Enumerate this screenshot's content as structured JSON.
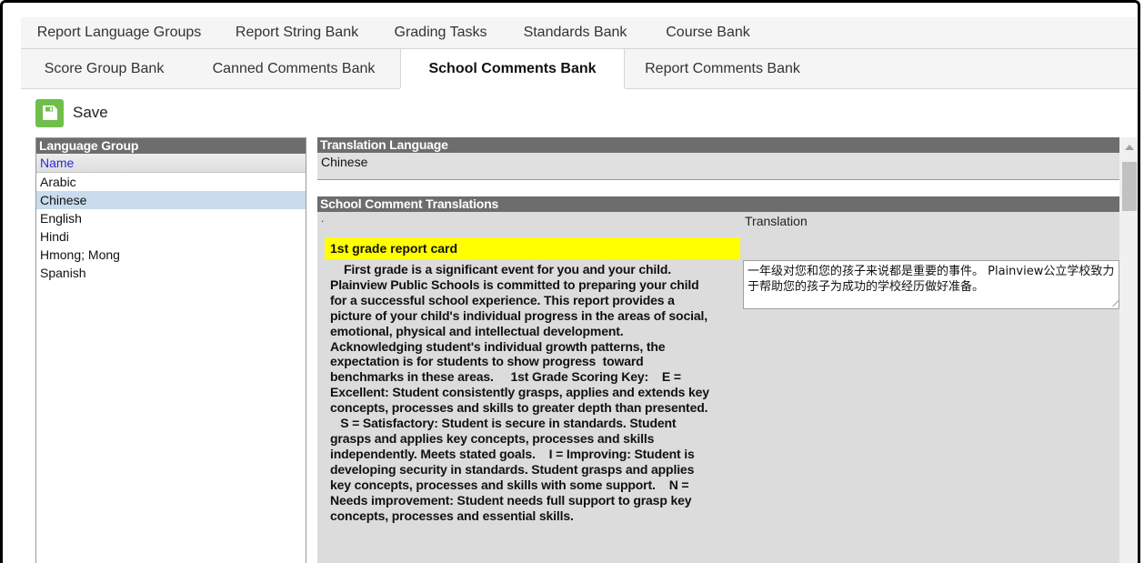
{
  "tabs_row1": [
    "Report Language Groups",
    "Report String Bank",
    "Grading Tasks",
    "Standards Bank",
    "Course Bank"
  ],
  "tabs_row2": [
    "Score Group Bank",
    "Canned Comments Bank",
    "School Comments Bank",
    "Report Comments Bank"
  ],
  "toolbar": {
    "save_label": "Save",
    "save_icon": "floppy-disk-icon"
  },
  "language_group": {
    "header": "Language Group",
    "column": "Name",
    "items": [
      "Arabic",
      "Chinese",
      "English",
      "Hindi",
      "Hmong; Mong",
      "Spanish"
    ],
    "selected": "Chinese"
  },
  "translation_language": {
    "header": "Translation Language",
    "value": "Chinese"
  },
  "school_comment_translations": {
    "header": "School Comment Translations",
    "dot": ".",
    "translation_label": "Translation",
    "comment_title": "1st grade report card",
    "comment_body": "    First grade is a significant event for you and your child.\nPlainview Public Schools is committed to preparing your child\nfor a successful school experience. This report provides a\npicture of your child's individual progress in the areas of social,\nemotional, physical and intellectual development.\nAcknowledging student's individual growth patterns, the\nexpectation is for students to show progress  toward\nbenchmarks in these areas.     1st Grade Scoring Key:    E =\nExcellent: Student consistently grasps, applies and extends key\nconcepts, processes and skills to greater depth than presented.\n   S = Satisfactory: Student is secure in standards. Student\ngrasps and applies key concepts, processes and skills\nindependently. Meets stated goals.    I = Improving: Student is\ndeveloping security in standards. Student grasps and applies\nkey concepts, processes and skills with some support.    N =\nNeeds improvement: Student needs full support to grasp key\nconcepts, processes and essential skills.",
    "translation_text": "一年级对您和您的孩子来说都是重要的事件。 Plainview公立学校致力于帮助您的孩子为成功的学校经历做好准备。"
  },
  "colors": {
    "active_tab": "#ffffff",
    "header_gray": "#6d6d6d",
    "selected_row": "#c8dcee",
    "highlight": "#ffff00",
    "save_green": "#6fbf4a"
  }
}
